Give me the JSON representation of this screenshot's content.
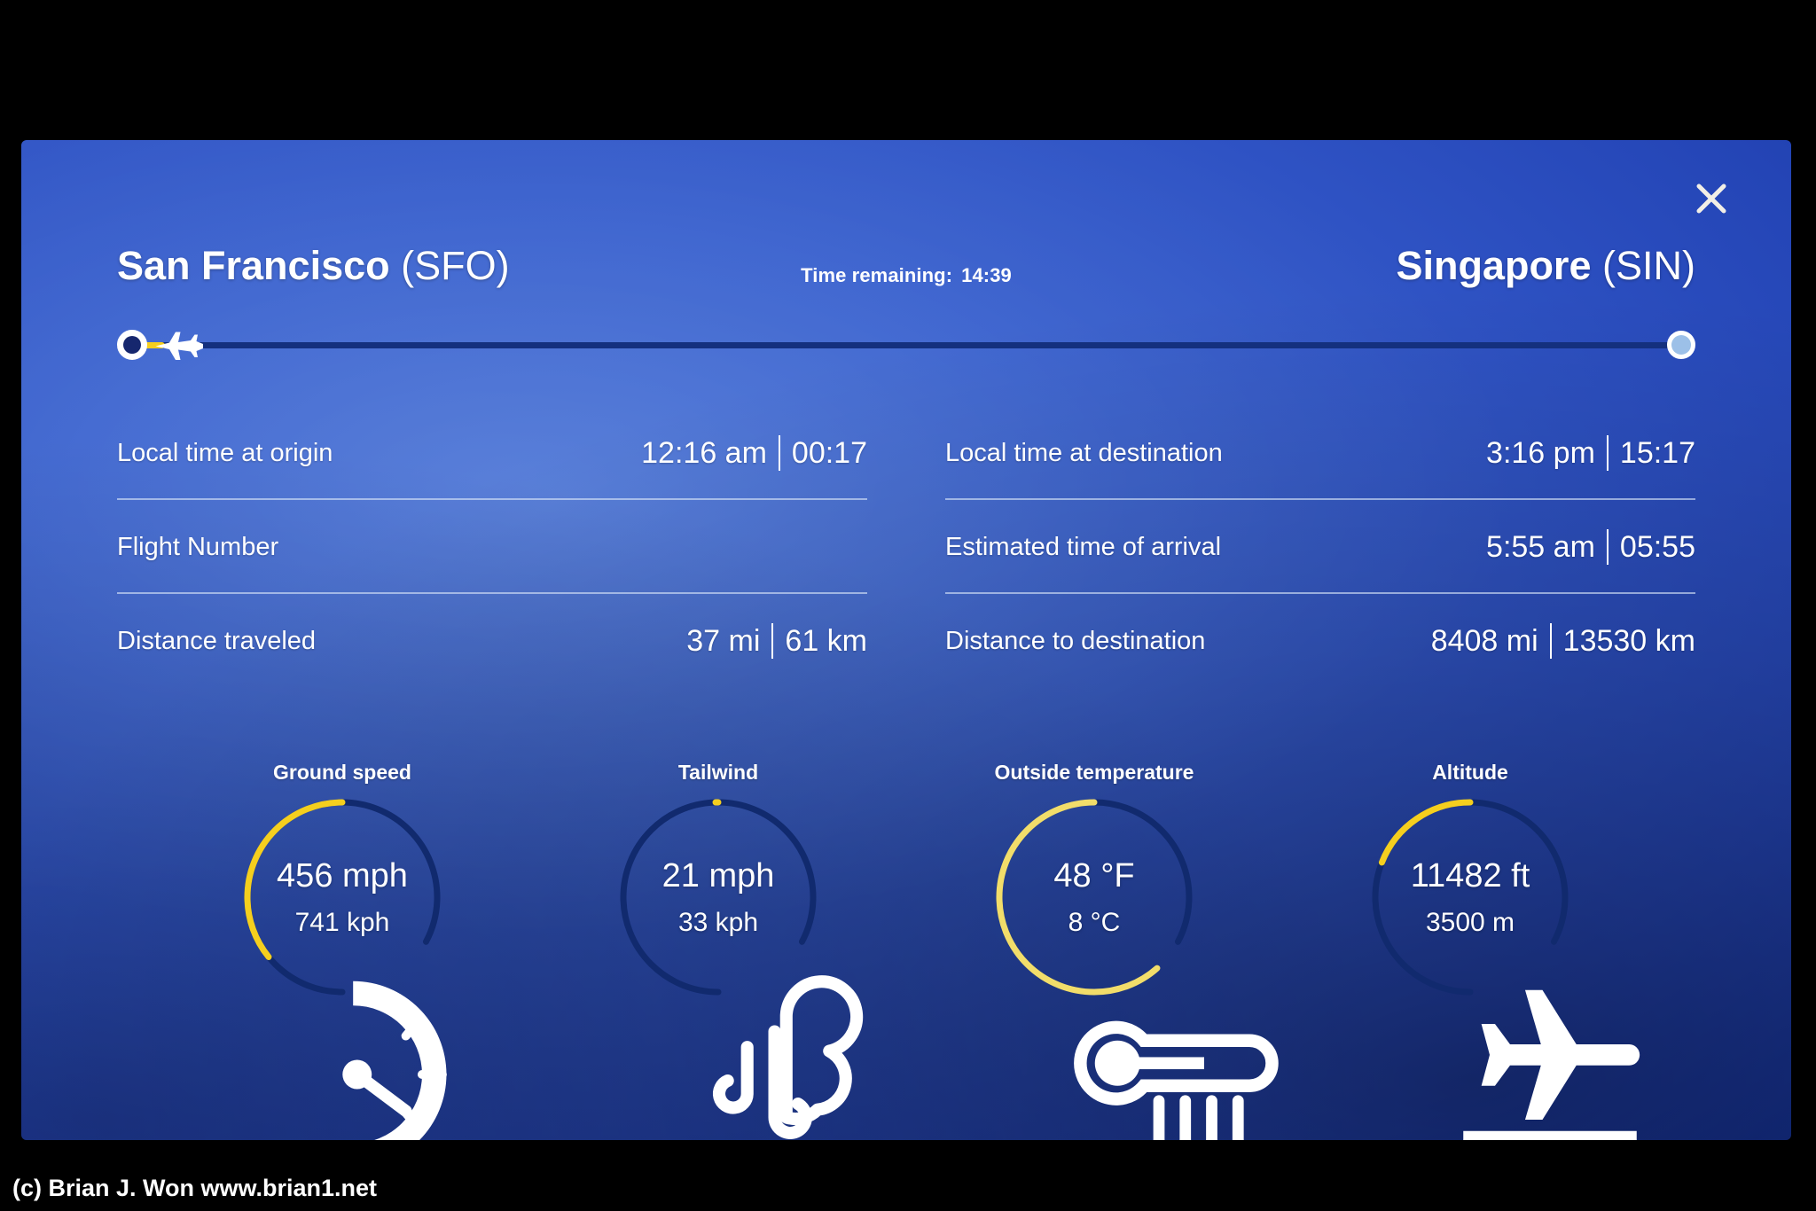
{
  "screen": {
    "close_label": "×",
    "accent_color": "#f5cf1e",
    "track_color": "#14307e",
    "background_color": "#2f53c4"
  },
  "route": {
    "origin": {
      "name": "San Francisco",
      "code": "(SFO)"
    },
    "destination": {
      "name": "Singapore",
      "code": "(SIN)"
    },
    "time_remaining_label": "Time remaining:",
    "time_remaining_value": "14:39",
    "progress_percent": 0.4
  },
  "info": {
    "left_rows": [
      {
        "label": "Local time at origin",
        "primary": "12:16 am",
        "secondary": "00:17"
      },
      {
        "label": "Flight Number",
        "primary": "",
        "secondary": ""
      },
      {
        "label": "Distance traveled",
        "primary": "37 mi",
        "secondary": "61 km"
      }
    ],
    "right_rows": [
      {
        "label": "Local time at destination",
        "primary": "3:16 pm",
        "secondary": "15:17"
      },
      {
        "label": "Estimated time of arrival",
        "primary": "5:55 am",
        "secondary": "05:55"
      },
      {
        "label": "Distance to destination",
        "primary": "8408 mi",
        "secondary": "13530 km"
      }
    ]
  },
  "chart_data": {
    "type": "gauge",
    "title": "Flight telemetry dials",
    "gauges": [
      {
        "id": "ground-speed",
        "title": "Ground speed",
        "primary": "456 mph",
        "secondary": "741 kph",
        "icon": "speedometer-icon",
        "fill_fraction": 0.47,
        "arc_color": "#f5cf1e",
        "track_color": "#112a6e"
      },
      {
        "id": "tailwind",
        "title": "Tailwind",
        "primary": "21 mph",
        "secondary": "33 kph",
        "icon": "wind-icon",
        "fill_fraction": 0.07,
        "arc_color": "#f5cf1e",
        "track_color": "#112a6e"
      },
      {
        "id": "outside-temperature",
        "title": "Outside temperature",
        "primary": "48 °F",
        "secondary": "8 °C",
        "icon": "thermometer-icon",
        "fill_fraction": 0.76,
        "arc_color": "#f2dd6a",
        "track_color": "#112a6e"
      },
      {
        "id": "altitude",
        "title": "Altitude",
        "primary": "11482 ft",
        "secondary": "3500 m",
        "icon": "altitude-plane-icon",
        "fill_fraction": 0.28,
        "arc_color": "#f5cf1e",
        "track_color": "#112a6e"
      }
    ]
  },
  "watermark": "(c) Brian J. Won www.brian1.net"
}
